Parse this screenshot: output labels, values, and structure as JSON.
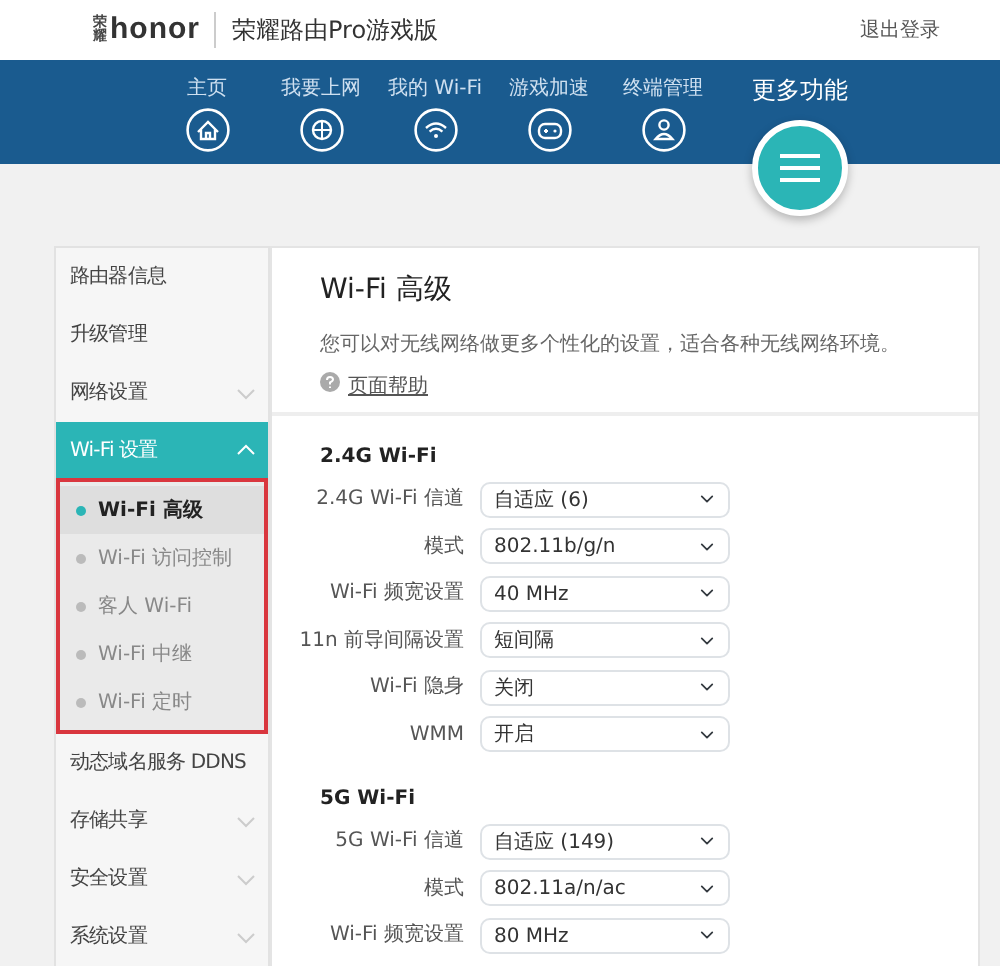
{
  "header": {
    "logo_mark": "荣耀",
    "logo": "honor",
    "product": "荣耀路由Pro游戏版",
    "logout": "退出登录"
  },
  "nav": {
    "items": [
      {
        "label": "主页"
      },
      {
        "label": "我要上网"
      },
      {
        "label": "我的 Wi-Fi"
      },
      {
        "label": "游戏加速"
      },
      {
        "label": "终端管理"
      }
    ],
    "more": {
      "label": "更多功能"
    }
  },
  "sidebar": {
    "items": [
      {
        "label": "路由器信息",
        "kind": "link",
        "selected": false
      },
      {
        "label": "升级管理",
        "kind": "link",
        "selected": false
      },
      {
        "label": "网络设置",
        "kind": "group",
        "selected": false,
        "expanded": false
      },
      {
        "label": "Wi-Fi 设置",
        "kind": "group",
        "selected": true,
        "expanded": true,
        "children": [
          {
            "label": "Wi-Fi 高级",
            "selected": true
          },
          {
            "label": "Wi-Fi 访问控制",
            "selected": false
          },
          {
            "label": "客人 Wi-Fi",
            "selected": false
          },
          {
            "label": "Wi-Fi 中继",
            "selected": false
          },
          {
            "label": "Wi-Fi 定时",
            "selected": false
          }
        ]
      },
      {
        "label": "动态域名服务 DDNS",
        "kind": "link",
        "selected": false
      },
      {
        "label": "存储共享",
        "kind": "group",
        "selected": false,
        "expanded": false
      },
      {
        "label": "安全设置",
        "kind": "group",
        "selected": false,
        "expanded": false
      },
      {
        "label": "系统设置",
        "kind": "group",
        "selected": false,
        "expanded": false
      }
    ]
  },
  "content": {
    "title": "Wi-Fi 高级",
    "description": "您可以对无线网络做更多个性化的设置，适合各种无线网络环境。",
    "help_link": "页面帮助",
    "sections": [
      {
        "title": "2.4G Wi-Fi",
        "rows": [
          {
            "label": "2.4G Wi-Fi 信道",
            "value": "自适应 (6)"
          },
          {
            "label": "模式",
            "value": "802.11b/g/n"
          },
          {
            "label": "Wi-Fi 频宽设置",
            "value": "40 MHz"
          },
          {
            "label": "11n 前导间隔设置",
            "value": "短间隔"
          },
          {
            "label": "Wi-Fi 隐身",
            "value": "关闭"
          },
          {
            "label": "WMM",
            "value": "开启"
          }
        ]
      },
      {
        "title": "5G Wi-Fi",
        "rows": [
          {
            "label": "5G Wi-Fi 信道",
            "value": "自适应 (149)"
          },
          {
            "label": "模式",
            "value": "802.11a/n/ac"
          },
          {
            "label": "Wi-Fi 频宽设置",
            "value": "80 MHz"
          }
        ]
      }
    ]
  }
}
